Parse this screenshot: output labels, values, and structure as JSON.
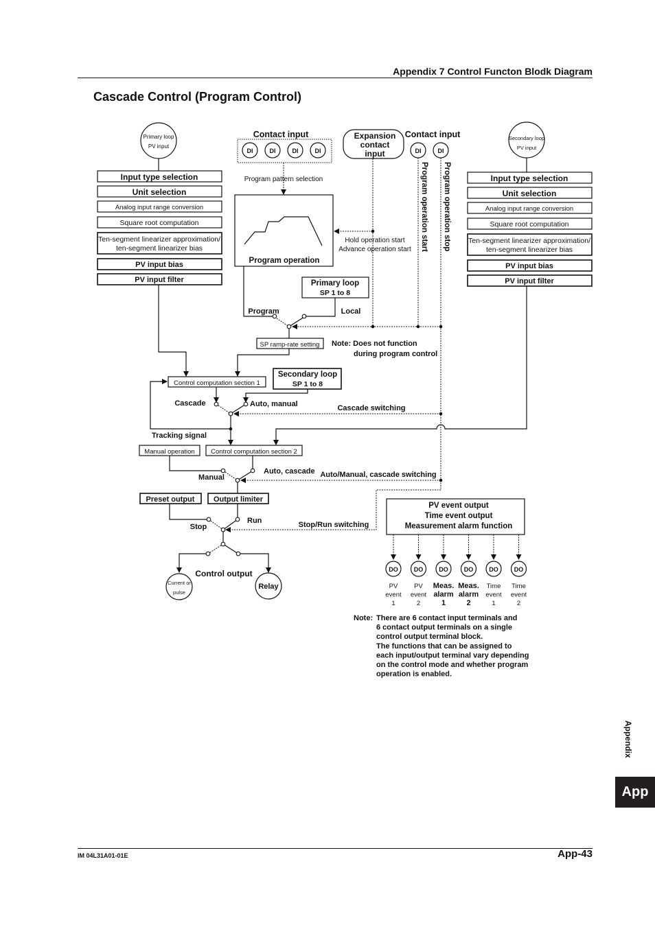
{
  "header": {
    "title": "Appendix 7 Control Functon Blodk Diagram"
  },
  "section_title": "Cascade Control (Program Control)",
  "footer": {
    "doc_id": "IM 04L31A01-01E",
    "page": "App-43"
  },
  "side_tab": {
    "label": "Appendix",
    "tab": "App"
  },
  "primary_input": {
    "circle_lines": [
      "Primary loop",
      "PV input"
    ],
    "blocks": [
      "Input type selection",
      "Unit selection",
      "Analog input range conversion",
      "Square root computation",
      "Ten-segment linearizer approximation/",
      "ten-segment linearizer bias",
      "PV input bias",
      "PV input filter"
    ]
  },
  "secondary_input": {
    "circle_lines": [
      "Secondary loop",
      "PV input"
    ],
    "blocks": [
      "Input type selection",
      "Unit selection",
      "Analog input range conversion",
      "Square root computation",
      "Ten-segment linearizer approximation/",
      "ten-segment linearizer bias",
      "PV input bias",
      "PV input filter"
    ]
  },
  "contact_input_left": {
    "label": "Contact input",
    "terminals": [
      "DI",
      "DI",
      "DI",
      "DI"
    ],
    "signal": "Program pattern selection"
  },
  "expansion": {
    "lines": [
      "Expansion",
      "contact",
      "input"
    ]
  },
  "contact_input_right": {
    "label": "Contact input",
    "terminals": [
      "DI",
      "DI"
    ],
    "signals": [
      "Program operation start",
      "Program operation stop"
    ]
  },
  "program_operation": {
    "label": "Program operation",
    "hold_lines": [
      "Hold operation start",
      "Advance operation start"
    ]
  },
  "primary_sp": {
    "lines": [
      "Primary loop",
      "SP 1 to 8"
    ]
  },
  "secondary_sp": {
    "lines": [
      "Secondary loop",
      "SP 1 to 8"
    ]
  },
  "switch_labels": {
    "program": "Program",
    "local": "Local",
    "cascade": "Cascade",
    "auto_manual": "Auto, manual",
    "cascade_switching": "Cascade switching",
    "tracking": "Tracking signal",
    "manual": "Manual",
    "auto_cascade": "Auto, cascade",
    "am_cascade_switching": "Auto/Manual, cascade switching",
    "stop": "Stop",
    "run": "Run",
    "stop_run_switching": "Stop/Run switching",
    "control_output": "Control output"
  },
  "blocks": {
    "sp_ramp": "SP ramp-rate setting",
    "ccs1": "Control computation section 1",
    "ccs2": "Control computation section 2",
    "manual_operation": "Manual operation",
    "preset_output": "Preset output",
    "output_limiter": "Output limiter"
  },
  "note_sp": [
    "Note: Does not function",
    "during program control"
  ],
  "outputs": {
    "current_pulse": [
      "Current or",
      "pulse"
    ],
    "relay": "Relay"
  },
  "event_block": {
    "lines": [
      "PV event output",
      "Time event output",
      "Measurement alarm function"
    ]
  },
  "do_terminals": [
    {
      "label": "DO",
      "caption": [
        "PV",
        "event",
        "1"
      ]
    },
    {
      "label": "DO",
      "caption": [
        "PV",
        "event",
        "2"
      ]
    },
    {
      "label": "DO",
      "caption": [
        "Meas.",
        "alarm",
        "1"
      ]
    },
    {
      "label": "DO",
      "caption": [
        "Meas.",
        "alarm",
        "2"
      ]
    },
    {
      "label": "DO",
      "caption": [
        "Time",
        "event",
        "1"
      ]
    },
    {
      "label": "DO",
      "caption": [
        "Time",
        "event",
        "2"
      ]
    }
  ],
  "note_bottom": {
    "prefix": "Note:",
    "lines": [
      "There are 6 contact input terminals and",
      "6 contact output terminals on a single",
      "control output terminal block.",
      "The functions that can be assigned to",
      "each input/output terminal vary depending",
      "on the control mode and whether program",
      "operation is enabled."
    ]
  }
}
